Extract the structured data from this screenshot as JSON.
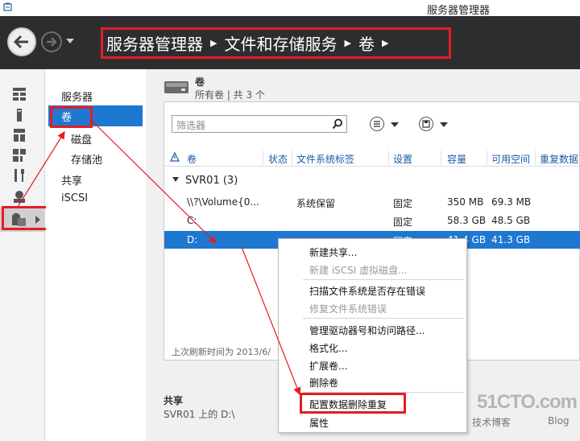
{
  "window": {
    "title": "服务器管理器"
  },
  "breadcrumb": {
    "items": [
      "服务器管理器",
      "文件和存储服务",
      "卷"
    ]
  },
  "nav": {
    "items": [
      {
        "label": "服务器",
        "level": 0
      },
      {
        "label": "卷",
        "level": 0,
        "selected": true
      },
      {
        "label": "磁盘",
        "level": 1
      },
      {
        "label": "存储池",
        "level": 1
      },
      {
        "label": "共享",
        "level": 0
      },
      {
        "label": "iSCSI",
        "level": 0
      }
    ]
  },
  "volumes": {
    "title": "卷",
    "subtitle": "所有卷 | 共 3 个",
    "filter_placeholder": "筛选器",
    "columns": [
      "卷",
      "状态",
      "文件系统标签",
      "设置",
      "容量",
      "可用空间",
      "重复数据"
    ],
    "group": "SVR01 (3)",
    "rows": [
      {
        "volume": "\\\\?\\Volume{0...",
        "status": "",
        "fs_label": "系统保留",
        "setting": "固定",
        "capacity": "350 MB",
        "free": "69.3 MB"
      },
      {
        "volume": "C:",
        "status": "",
        "fs_label": "",
        "setting": "固定",
        "capacity": "58.3 GB",
        "free": "48.5 GB"
      },
      {
        "volume": "D:",
        "status": "",
        "fs_label": "",
        "setting": "固定",
        "capacity": "41.4 GB",
        "free": "41.3 GB",
        "selected": true
      }
    ],
    "last_refresh": "上次刷新时间为 2013/6/"
  },
  "shares": {
    "title": "共享",
    "subtitle": "SVR01 上的 D:\\"
  },
  "context_menu": {
    "items": [
      {
        "label": "新建共享...",
        "enabled": true
      },
      {
        "label": "新建 iSCSI 虚拟磁盘...",
        "enabled": false
      },
      {
        "label": "扫描文件系统是否存在错误",
        "enabled": true
      },
      {
        "label": "修复文件系统错误",
        "enabled": false
      },
      {
        "label": "管理驱动器号和访问路径...",
        "enabled": true
      },
      {
        "label": "格式化...",
        "enabled": true
      },
      {
        "label": "扩展卷...",
        "enabled": true
      },
      {
        "label": "删除卷",
        "enabled": true
      },
      {
        "label": "配置数据删除重复",
        "enabled": true,
        "highlighted": true
      },
      {
        "label": "属性",
        "enabled": true
      }
    ]
  },
  "watermark": {
    "main": "51CTO.com",
    "sub": "技术博客",
    "blog": "Blog"
  },
  "colors": {
    "accent": "#1e78d0",
    "annotation": "#e51c23",
    "header_bg": "#2d2d30"
  }
}
